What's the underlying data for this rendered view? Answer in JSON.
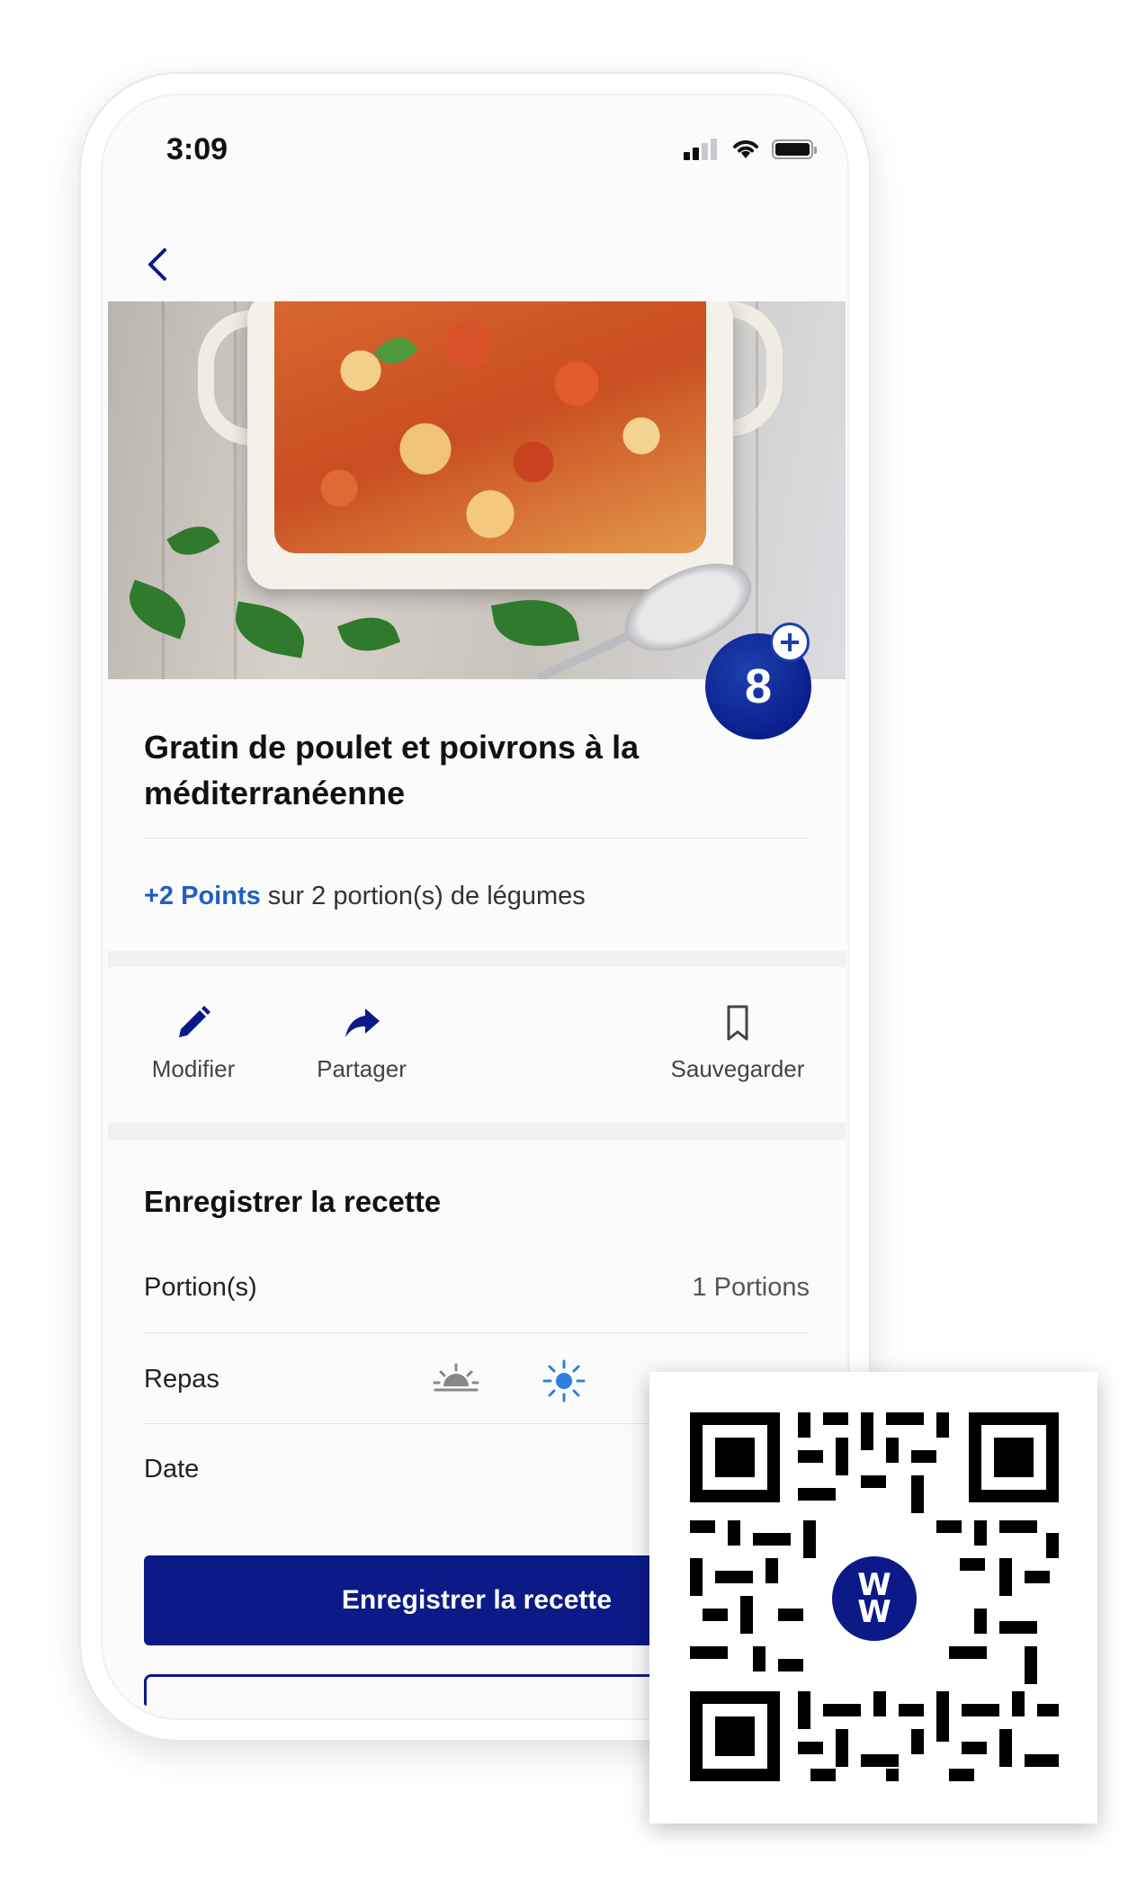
{
  "status_bar": {
    "time": "3:09"
  },
  "recipe": {
    "title": "Gratin de poulet et poivrons à la méditerranéenne",
    "points": "8",
    "veggie_points_accent": "+2 Points",
    "veggie_points_text": " sur 2 portion(s) de légumes"
  },
  "actions": {
    "edit": {
      "label": "Modifier",
      "icon": "pencil-icon"
    },
    "share": {
      "label": "Partager",
      "icon": "share-arrow-icon"
    },
    "save": {
      "label": "Sauvegarder",
      "icon": "bookmark-icon"
    }
  },
  "log": {
    "title": "Enregistrer la recette",
    "portions_label": "Portion(s)",
    "portions_value": "1 Portions",
    "meal_label": "Repas",
    "date_label": "Date",
    "button_label": "Enregistrer la recette"
  },
  "overlay": {
    "logo_text_top": "W",
    "logo_text_bottom": "W"
  },
  "colors": {
    "brand_navy": "#0b1a87",
    "accent_blue": "#1f5fc4",
    "badge_blue": "#0a1f8c"
  }
}
